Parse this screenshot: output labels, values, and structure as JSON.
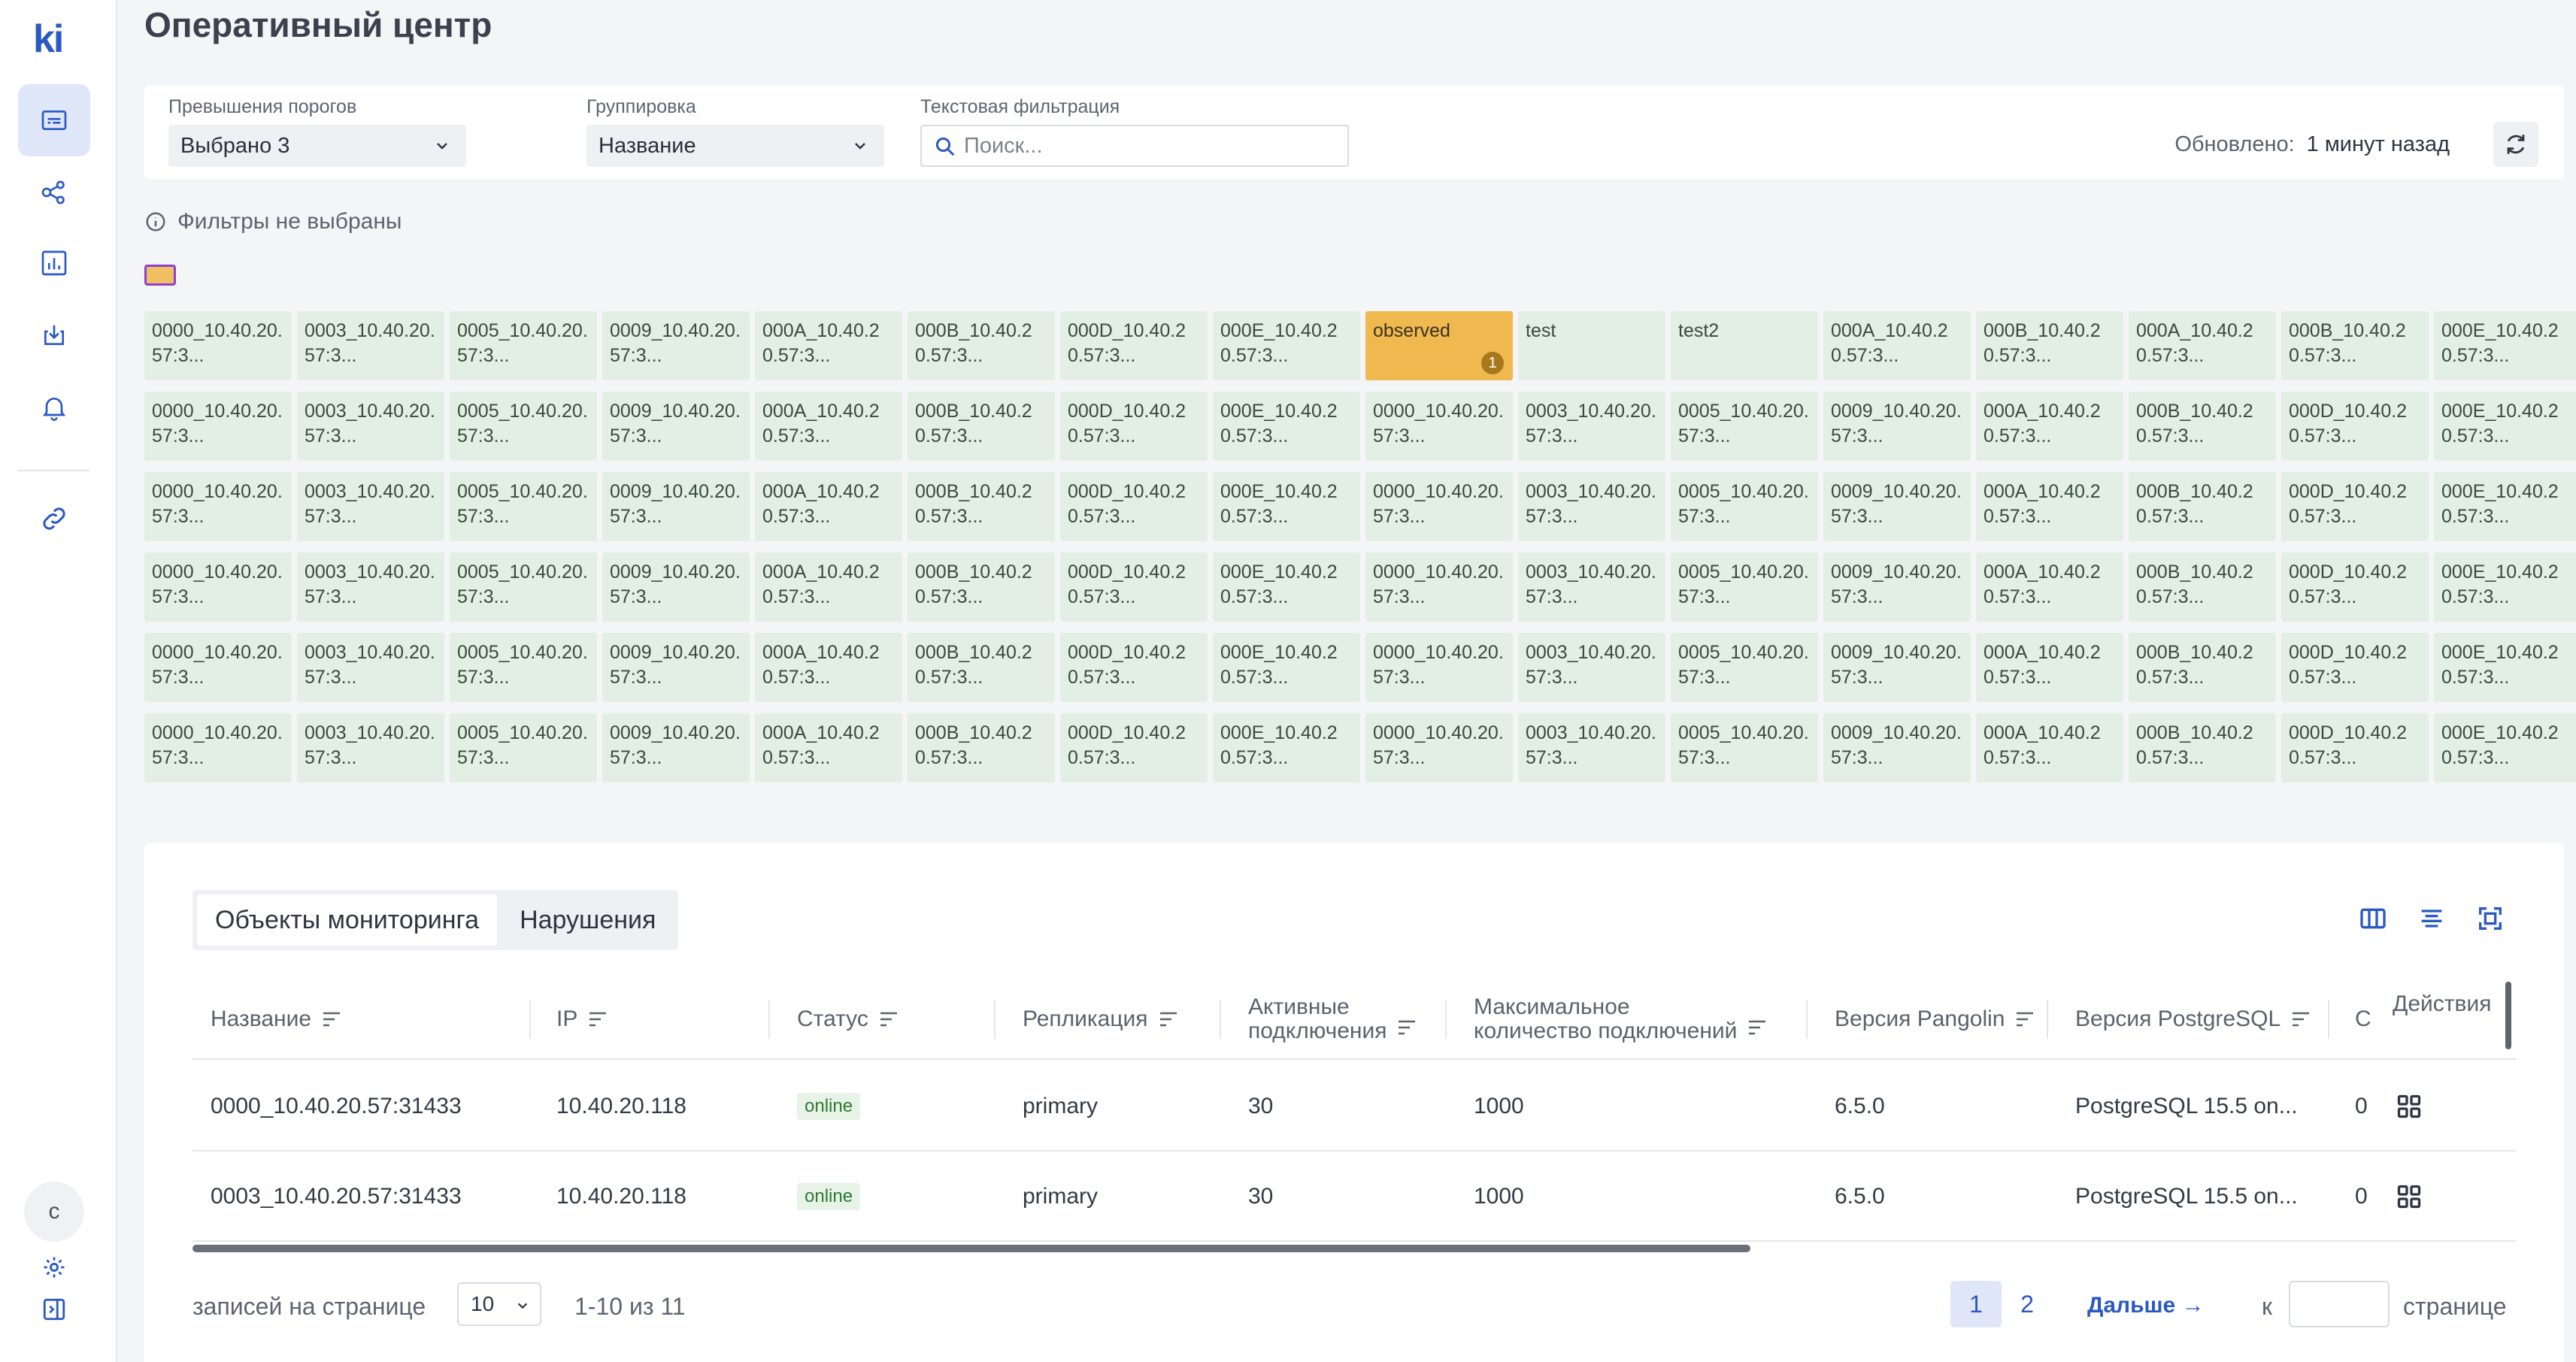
{
  "app": {
    "logo": "ki"
  },
  "sidebar": {
    "avatar_letter": "с"
  },
  "page": {
    "title": "Оперативный центр"
  },
  "filters": {
    "threshold_label": "Превышения порогов",
    "threshold_value": "Выбрано 3",
    "grouping_label": "Группировка",
    "grouping_value": "Название",
    "text_filter_label": "Текстовая фильтрация",
    "search_placeholder": "Поиск...",
    "updated_label": "Обновлено:",
    "updated_value": "1 минут назад",
    "no_filters": "Фильтры не выбраны"
  },
  "tiles": [
    [
      "0000_10.40.20.57:3...",
      "0003_10.40.20.57:3...",
      "0005_10.40.20.57:3...",
      "0009_10.40.20.57:3...",
      "000A_10.40.20.57:3...",
      "000B_10.40.20.57:3...",
      "000D_10.40.20.57:3...",
      "000E_10.40.20.57:3...",
      "observed",
      "test",
      "test2",
      "000A_10.40.20.57:3...",
      "000B_10.40.20.57:3...",
      "000A_10.40.20.57:3...",
      "000B_10.40.20.57:3...",
      "000E_10.40.20.57:3..."
    ],
    [
      "0000_10.40.20.57:3...",
      "0003_10.40.20.57:3...",
      "0005_10.40.20.57:3...",
      "0009_10.40.20.57:3...",
      "000A_10.40.20.57:3...",
      "000B_10.40.20.57:3...",
      "000D_10.40.20.57:3...",
      "000E_10.40.20.57:3...",
      "0000_10.40.20.57:3...",
      "0003_10.40.20.57:3...",
      "0005_10.40.20.57:3...",
      "0009_10.40.20.57:3...",
      "000A_10.40.20.57:3...",
      "000B_10.40.20.57:3...",
      "000D_10.40.20.57:3...",
      "000E_10.40.20.57:3..."
    ],
    [
      "0000_10.40.20.57:3...",
      "0003_10.40.20.57:3...",
      "0005_10.40.20.57:3...",
      "0009_10.40.20.57:3...",
      "000A_10.40.20.57:3...",
      "000B_10.40.20.57:3...",
      "000D_10.40.20.57:3...",
      "000E_10.40.20.57:3...",
      "0000_10.40.20.57:3...",
      "0003_10.40.20.57:3...",
      "0005_10.40.20.57:3...",
      "0009_10.40.20.57:3...",
      "000A_10.40.20.57:3...",
      "000B_10.40.20.57:3...",
      "000D_10.40.20.57:3...",
      "000E_10.40.20.57:3..."
    ],
    [
      "0000_10.40.20.57:3...",
      "0003_10.40.20.57:3...",
      "0005_10.40.20.57:3...",
      "0009_10.40.20.57:3...",
      "000A_10.40.20.57:3...",
      "000B_10.40.20.57:3...",
      "000D_10.40.20.57:3...",
      "000E_10.40.20.57:3...",
      "0000_10.40.20.57:3...",
      "0003_10.40.20.57:3...",
      "0005_10.40.20.57:3...",
      "0009_10.40.20.57:3...",
      "000A_10.40.20.57:3...",
      "000B_10.40.20.57:3...",
      "000D_10.40.20.57:3...",
      "000E_10.40.20.57:3..."
    ],
    [
      "0000_10.40.20.57:3...",
      "0003_10.40.20.57:3...",
      "0005_10.40.20.57:3...",
      "0009_10.40.20.57:3...",
      "000A_10.40.20.57:3...",
      "000B_10.40.20.57:3...",
      "000D_10.40.20.57:3...",
      "000E_10.40.20.57:3...",
      "0000_10.40.20.57:3...",
      "0003_10.40.20.57:3...",
      "0005_10.40.20.57:3...",
      "0009_10.40.20.57:3...",
      "000A_10.40.20.57:3...",
      "000B_10.40.20.57:3...",
      "000D_10.40.20.57:3...",
      "000E_10.40.20.57:3..."
    ],
    [
      "0000_10.40.20.57:3...",
      "0003_10.40.20.57:3...",
      "0005_10.40.20.57:3...",
      "0009_10.40.20.57:3...",
      "000A_10.40.20.57:3...",
      "000B_10.40.20.57:3...",
      "000D_10.40.20.57:3...",
      "000E_10.40.20.57:3...",
      "0000_10.40.20.57:3...",
      "0003_10.40.20.57:3...",
      "0005_10.40.20.57:3...",
      "0009_10.40.20.57:3...",
      "000A_10.40.20.57:3...",
      "000B_10.40.20.57:3...",
      "000D_10.40.20.57:3...",
      "000E_10.40.20.57:3..."
    ]
  ],
  "observed_count": "1",
  "colors": {
    "tile_ok": "#e3efe4",
    "tile_warn": "#efb950",
    "accent": "#2b59c3"
  },
  "table": {
    "tabs": [
      "Объекты мониторинга",
      "Нарушения"
    ],
    "columns": {
      "name": "Название",
      "ip": "IP",
      "status": "Статус",
      "replication": "Репликация",
      "active_conn_1": "Активные",
      "active_conn_2": "подключения",
      "max_conn_1": "Максимальное",
      "max_conn_2": "количество подключений",
      "pangolin": "Версия Pangolin",
      "postgres": "Версия PostgreSQL",
      "c": "С",
      "actions": "Действия"
    },
    "rows": [
      {
        "name": "0000_10.40.20.57:31433",
        "ip": "10.40.20.118",
        "status": "online",
        "replication": "primary",
        "active": "30",
        "max": "1000",
        "pangolin": "6.5.0",
        "postgres": "PostgreSQL 15.5 on...",
        "c": "0"
      },
      {
        "name": "0003_10.40.20.57:31433",
        "ip": "10.40.20.118",
        "status": "online",
        "replication": "primary",
        "active": "30",
        "max": "1000",
        "pangolin": "6.5.0",
        "postgres": "PostgreSQL 15.5 on...",
        "c": "0"
      }
    ]
  },
  "pagination": {
    "per_page_label": "записей на странице",
    "per_page_value": "10",
    "range": "1-10 из 11",
    "pages": [
      "1",
      "2"
    ],
    "next": "Дальше →",
    "to_label": "к",
    "page_label": "странице"
  }
}
